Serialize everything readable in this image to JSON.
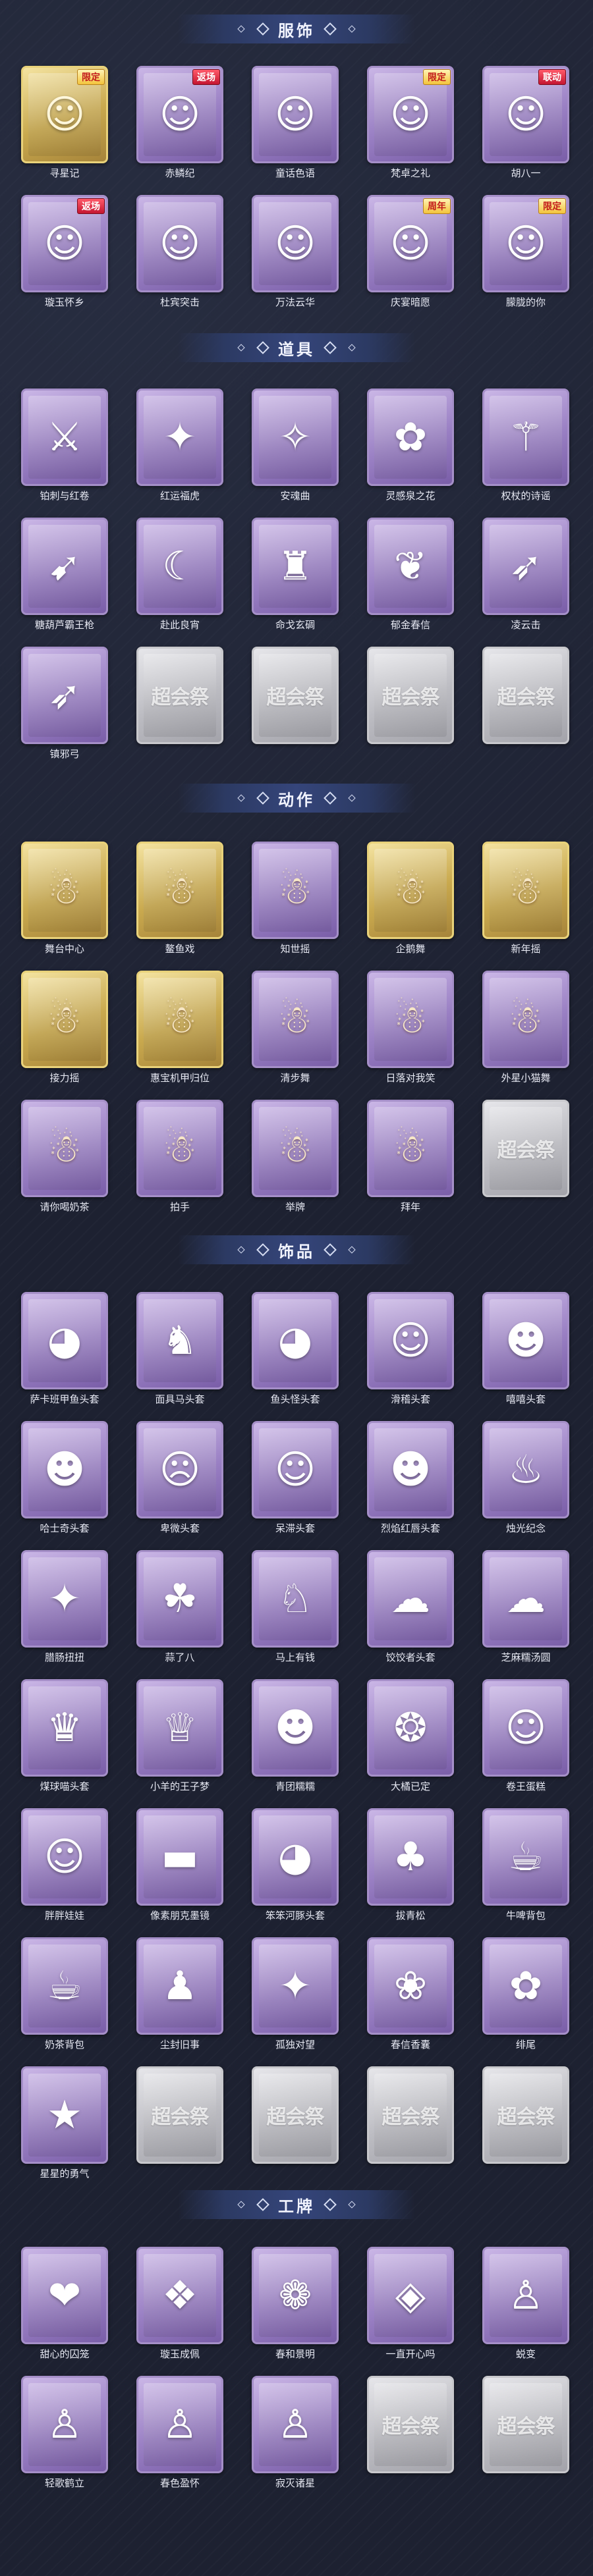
{
  "sections": [
    {
      "title": "服饰",
      "items": [
        {
          "name": "寻星记",
          "frame": "gold",
          "icon": "portrait-icon",
          "glyph": "☺",
          "badge": "限定"
        },
        {
          "name": "赤鳞纪",
          "frame": "purple",
          "icon": "portrait-icon",
          "glyph": "☺",
          "badge": "返场"
        },
        {
          "name": "童话色语",
          "frame": "purple",
          "icon": "portrait-icon",
          "glyph": "☺"
        },
        {
          "name": "梵卓之礼",
          "frame": "purple",
          "icon": "portrait-icon",
          "glyph": "☺",
          "badge": "限定"
        },
        {
          "name": "胡八一",
          "frame": "purple",
          "icon": "portrait-icon",
          "glyph": "☺",
          "badge": "联动"
        },
        {
          "name": "璇玉怀乡",
          "frame": "purple",
          "icon": "portrait-icon",
          "glyph": "☺",
          "badge": "返场"
        },
        {
          "name": "杜宾突击",
          "frame": "purple",
          "icon": "portrait-icon",
          "glyph": "☺"
        },
        {
          "name": "万法云华",
          "frame": "purple",
          "icon": "portrait-icon",
          "glyph": "☺"
        },
        {
          "name": "庆宴暗愿",
          "frame": "purple",
          "icon": "portrait-icon",
          "glyph": "☺",
          "badge": "周年"
        },
        {
          "name": "朦胧的你",
          "frame": "purple",
          "icon": "portrait-icon",
          "glyph": "☺",
          "badge": "限定"
        }
      ]
    },
    {
      "title": "道具",
      "items": [
        {
          "name": "铂刺与红卷",
          "frame": "purple",
          "icon": "sword-icon",
          "glyph": "⚔"
        },
        {
          "name": "红运福虎",
          "frame": "purple",
          "icon": "tiger-icon",
          "glyph": "✦"
        },
        {
          "name": "安魂曲",
          "frame": "purple",
          "icon": "gun-icon",
          "glyph": "✧"
        },
        {
          "name": "灵感泉之花",
          "frame": "purple",
          "icon": "flower-icon",
          "glyph": "✿"
        },
        {
          "name": "权杖的诗谣",
          "frame": "purple",
          "icon": "staff-icon",
          "glyph": "⚚"
        },
        {
          "name": "糖葫芦霸王枪",
          "frame": "purple",
          "icon": "spear-icon",
          "glyph": "➹"
        },
        {
          "name": "赴此良宵",
          "frame": "purple",
          "icon": "boat-icon",
          "glyph": "☾"
        },
        {
          "name": "命戈玄碉",
          "frame": "purple",
          "icon": "lantern-icon",
          "glyph": "♜"
        },
        {
          "name": "郁金春信",
          "frame": "purple",
          "icon": "fan-icon",
          "glyph": "❦"
        },
        {
          "name": "凌云击",
          "frame": "purple",
          "icon": "bow-icon",
          "glyph": "➶"
        },
        {
          "name": "镇邪弓",
          "frame": "purple",
          "icon": "bow-icon",
          "glyph": "➶"
        },
        {
          "name": "",
          "frame": "grey",
          "icon": "placeholder-logo",
          "ph": "超会祭"
        },
        {
          "name": "",
          "frame": "grey",
          "icon": "placeholder-logo",
          "ph": "超会祭"
        },
        {
          "name": "",
          "frame": "grey",
          "icon": "placeholder-logo",
          "ph": "超会祭"
        },
        {
          "name": "",
          "frame": "grey",
          "icon": "placeholder-logo",
          "ph": "超会祭"
        }
      ]
    },
    {
      "title": "动作",
      "items": [
        {
          "name": "舞台中心",
          "frame": "gold",
          "icon": "pose-icon",
          "glyph": "☃"
        },
        {
          "name": "鳌鱼戏",
          "frame": "gold",
          "icon": "pose-icon",
          "glyph": "☃"
        },
        {
          "name": "知世摇",
          "frame": "purple",
          "icon": "pose-icon",
          "glyph": "☃"
        },
        {
          "name": "企鹅舞",
          "frame": "gold",
          "icon": "pose-icon",
          "glyph": "☃"
        },
        {
          "name": "新年摇",
          "frame": "gold",
          "icon": "pose-icon",
          "glyph": "☃"
        },
        {
          "name": "接力摇",
          "frame": "gold",
          "icon": "pose-icon",
          "glyph": "☃"
        },
        {
          "name": "惠宝机甲归位",
          "frame": "gold",
          "icon": "pose-icon",
          "glyph": "☃"
        },
        {
          "name": "清步舞",
          "frame": "purple",
          "icon": "pose-icon",
          "glyph": "☃"
        },
        {
          "name": "日落对我笑",
          "frame": "purple",
          "icon": "pose-icon",
          "glyph": "☃"
        },
        {
          "name": "外星小猫舞",
          "frame": "purple",
          "icon": "pose-icon",
          "glyph": "☃"
        },
        {
          "name": "请你喝奶茶",
          "frame": "purple",
          "icon": "pose-icon",
          "glyph": "☃"
        },
        {
          "name": "拍手",
          "frame": "purple",
          "icon": "pose-icon",
          "glyph": "☃"
        },
        {
          "name": "举牌",
          "frame": "purple",
          "icon": "pose-icon",
          "glyph": "☃"
        },
        {
          "name": "拜年",
          "frame": "purple",
          "icon": "pose-icon",
          "glyph": "☃"
        },
        {
          "name": "",
          "frame": "grey",
          "icon": "placeholder-logo",
          "ph": "超会祭"
        }
      ]
    },
    {
      "title": "饰品",
      "items": [
        {
          "name": "萨卡班甲鱼头套",
          "frame": "purple",
          "icon": "fish-head-icon",
          "glyph": "◕"
        },
        {
          "name": "面具马头套",
          "frame": "purple",
          "icon": "horse-head-icon",
          "glyph": "♞"
        },
        {
          "name": "鱼头怪头套",
          "frame": "purple",
          "icon": "fish-head-icon",
          "glyph": "◕"
        },
        {
          "name": "滑稽头套",
          "frame": "purple",
          "icon": "smiley-icon",
          "glyph": "☺"
        },
        {
          "name": "嘻嘻头套",
          "frame": "purple",
          "icon": "grin-icon",
          "glyph": "☻"
        },
        {
          "name": "哈士奇头套",
          "frame": "purple",
          "icon": "dog-head-icon",
          "glyph": "☻"
        },
        {
          "name": "卑微头套",
          "frame": "purple",
          "icon": "emoji-icon",
          "glyph": "☹"
        },
        {
          "name": "呆滞头套",
          "frame": "purple",
          "icon": "emoji-icon",
          "glyph": "☺"
        },
        {
          "name": "烈焰红唇头套",
          "frame": "purple",
          "icon": "emoji-icon",
          "glyph": "☻"
        },
        {
          "name": "烛光纪念",
          "frame": "purple",
          "icon": "candle-icon",
          "glyph": "♨"
        },
        {
          "name": "腊肠扭扭",
          "frame": "purple",
          "icon": "dog-icon",
          "glyph": "✦"
        },
        {
          "name": "蒜了八",
          "frame": "purple",
          "icon": "garlic-icon",
          "glyph": "☘"
        },
        {
          "name": "马上有钱",
          "frame": "purple",
          "icon": "horse-icon",
          "glyph": "♘"
        },
        {
          "name": "饺饺者头套",
          "frame": "purple",
          "icon": "dumpling-icon",
          "glyph": "☁"
        },
        {
          "name": "芝麻糯汤圆",
          "frame": "purple",
          "icon": "tangyuan-icon",
          "glyph": "☁"
        },
        {
          "name": "煤球喵头套",
          "frame": "purple",
          "icon": "cat-head-icon",
          "glyph": "♛"
        },
        {
          "name": "小羊的王子梦",
          "frame": "purple",
          "icon": "sheep-icon",
          "glyph": "♕"
        },
        {
          "name": "青团糯糯",
          "frame": "purple",
          "icon": "qingtuan-icon",
          "glyph": "☻"
        },
        {
          "name": "大橘已定",
          "frame": "purple",
          "icon": "orange-icon",
          "glyph": "❂"
        },
        {
          "name": "卷王蛋糕",
          "frame": "purple",
          "icon": "cake-icon",
          "glyph": "☺"
        },
        {
          "name": "胖胖娃娃",
          "frame": "purple",
          "icon": "doll-icon",
          "glyph": "☺"
        },
        {
          "name": "像素朋克墨镜",
          "frame": "purple",
          "icon": "sunglasses-icon",
          "glyph": "▬"
        },
        {
          "name": "笨笨河豚头套",
          "frame": "purple",
          "icon": "pufferfish-icon",
          "glyph": "◕"
        },
        {
          "name": "拔青松",
          "frame": "purple",
          "icon": "tree-icon",
          "glyph": "♣"
        },
        {
          "name": "牛啤背包",
          "frame": "purple",
          "icon": "beer-icon",
          "glyph": "☕"
        },
        {
          "name": "奶茶背包",
          "frame": "purple",
          "icon": "milktea-icon",
          "glyph": "☕"
        },
        {
          "name": "尘封旧事",
          "frame": "purple",
          "icon": "figure-icon",
          "glyph": "♟"
        },
        {
          "name": "孤独对望",
          "frame": "purple",
          "icon": "charm-icon",
          "glyph": "✦"
        },
        {
          "name": "春信香囊",
          "frame": "purple",
          "icon": "sachet-icon",
          "glyph": "❀"
        },
        {
          "name": "绯尾",
          "frame": "purple",
          "icon": "tail-icon",
          "glyph": "✿"
        },
        {
          "name": "星星的勇气",
          "frame": "purple",
          "icon": "star-charm-icon",
          "glyph": "★"
        },
        {
          "name": "",
          "frame": "grey",
          "icon": "placeholder-logo",
          "ph": "超会祭"
        },
        {
          "name": "",
          "frame": "grey",
          "icon": "placeholder-logo",
          "ph": "超会祭"
        },
        {
          "name": "",
          "frame": "grey",
          "icon": "placeholder-logo",
          "ph": "超会祭"
        },
        {
          "name": "",
          "frame": "grey",
          "icon": "placeholder-logo",
          "ph": "超会祭"
        }
      ]
    },
    {
      "title": "工牌",
      "items": [
        {
          "name": "甜心的囚笼",
          "frame": "purple",
          "icon": "card-icon",
          "glyph": "❤"
        },
        {
          "name": "璇玉成佩",
          "frame": "purple",
          "icon": "card-icon",
          "glyph": "❖"
        },
        {
          "name": "春和景明",
          "frame": "purple",
          "icon": "card-icon",
          "glyph": "❁"
        },
        {
          "name": "一直开心吗",
          "frame": "purple",
          "icon": "card-icon",
          "glyph": "◈"
        },
        {
          "name": "蜕变",
          "frame": "purple",
          "icon": "card-icon",
          "glyph": "♙"
        },
        {
          "name": "轻歌鹤立",
          "frame": "purple",
          "icon": "card-icon",
          "glyph": "♙"
        },
        {
          "name": "春色盈怀",
          "frame": "purple",
          "icon": "card-icon",
          "glyph": "♙"
        },
        {
          "name": "寂灭诸星",
          "frame": "purple",
          "icon": "card-icon",
          "glyph": "♙"
        },
        {
          "name": "",
          "frame": "grey",
          "icon": "placeholder-logo",
          "ph": "超会祭"
        },
        {
          "name": "",
          "frame": "grey",
          "icon": "placeholder-logo",
          "ph": "超会祭"
        }
      ]
    }
  ]
}
